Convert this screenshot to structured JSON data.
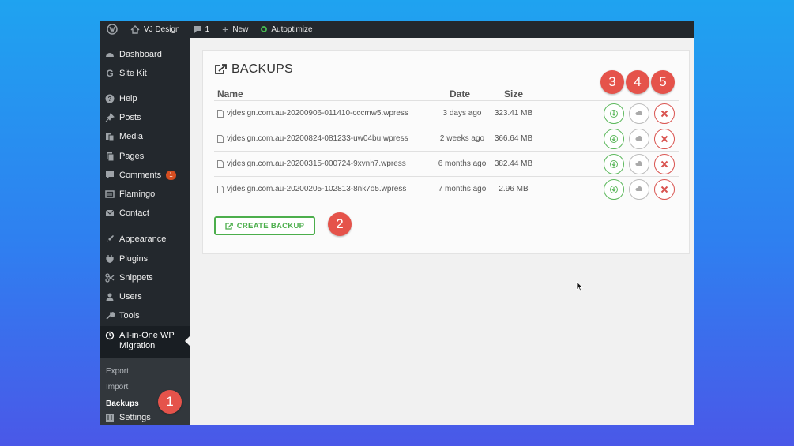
{
  "adminbar": {
    "site_name": "VJ Design",
    "comments_count": "1",
    "new_label": "New",
    "autoptimize_label": "Autoptimize"
  },
  "sidebar": {
    "items": [
      {
        "label": "Dashboard",
        "icon": "dashboard-icon"
      },
      {
        "label": "Site Kit",
        "icon": "google-icon"
      },
      {
        "label": "Help",
        "icon": "help-icon"
      },
      {
        "label": "Posts",
        "icon": "pin-icon"
      },
      {
        "label": "Media",
        "icon": "media-icon"
      },
      {
        "label": "Pages",
        "icon": "pages-icon"
      },
      {
        "label": "Comments",
        "icon": "comment-icon",
        "badge": "1"
      },
      {
        "label": "Flamingo",
        "icon": "flamingo-icon"
      },
      {
        "label": "Contact",
        "icon": "mail-icon"
      },
      {
        "label": "Appearance",
        "icon": "brush-icon"
      },
      {
        "label": "Plugins",
        "icon": "plugin-icon"
      },
      {
        "label": "Snippets",
        "icon": "scissors-icon"
      },
      {
        "label": "Users",
        "icon": "user-icon"
      },
      {
        "label": "Tools",
        "icon": "wrench-icon"
      }
    ],
    "current": {
      "label_line1": "All-in-One WP",
      "label_line2": "Migration"
    },
    "submenu": [
      "Export",
      "Import",
      "Backups"
    ],
    "settings_label": "Settings"
  },
  "panel": {
    "title": "BACKUPS",
    "headers": {
      "name": "Name",
      "date": "Date",
      "size": "Size"
    },
    "rows": [
      {
        "name": "vjdesign.com.au-20200906-011410-cccmw5.wpress",
        "date": "3 days ago",
        "size": "323.41 MB"
      },
      {
        "name": "vjdesign.com.au-20200824-081233-uw04bu.wpress",
        "date": "2 weeks ago",
        "size": "366.64 MB"
      },
      {
        "name": "vjdesign.com.au-20200315-000724-9xvnh7.wpress",
        "date": "6 months ago",
        "size": "382.44 MB"
      },
      {
        "name": "vjdesign.com.au-20200205-102813-8nk7o5.wpress",
        "date": "7 months ago",
        "size": "2.96 MB"
      }
    ],
    "create_label": "CREATE BACKUP"
  },
  "callouts": [
    "1",
    "2",
    "3",
    "4",
    "5"
  ],
  "colors": {
    "callout": "#e5534b",
    "download": "#5cb85c",
    "delete": "#d9534f",
    "sidebar": "#23282d"
  }
}
